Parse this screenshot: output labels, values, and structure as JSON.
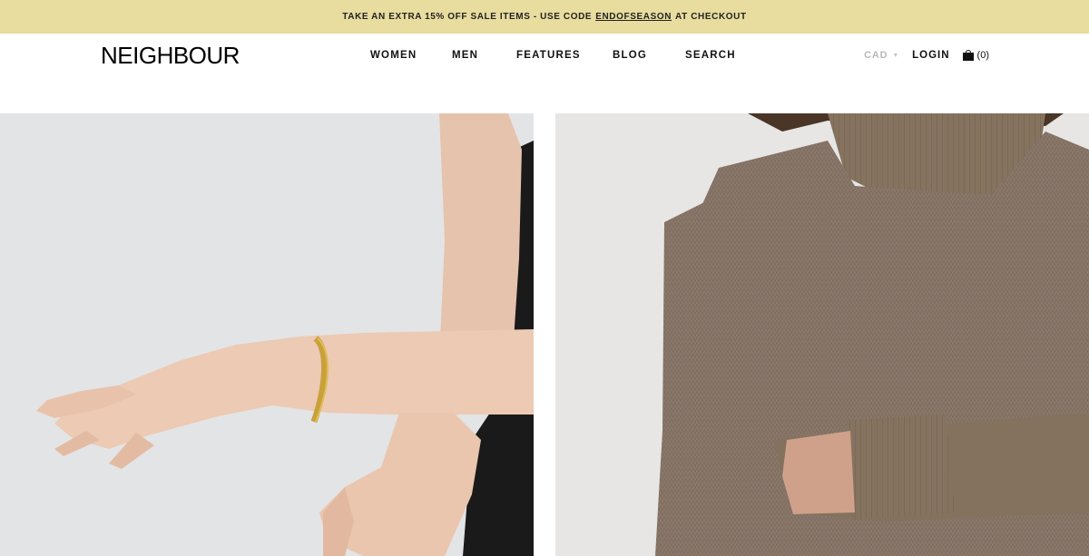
{
  "promo": {
    "text_before": "TAKE AN EXTRA 15% OFF SALE ITEMS - USE CODE",
    "code": "ENDOFSEASON",
    "text_after": "AT CHECKOUT"
  },
  "header": {
    "logo": "NEIGHBOUR",
    "nav": [
      {
        "label": "WOMEN"
      },
      {
        "label": "MEN"
      },
      {
        "label": "FEATURES"
      },
      {
        "label": "BLOG"
      },
      {
        "label": "SEARCH"
      }
    ],
    "currency": "CAD",
    "login": "LOGIN",
    "cart_count": "(0)"
  },
  "panels": [
    {
      "subject": "arm-with-gold-bracelet"
    },
    {
      "subject": "person-in-brown-knit-turtleneck"
    }
  ],
  "colors": {
    "promo_bg": "#e8dc9e",
    "left_bg": "#e3e4e6",
    "right_bg": "#e7e6e5",
    "sweater": "#8a786a"
  }
}
